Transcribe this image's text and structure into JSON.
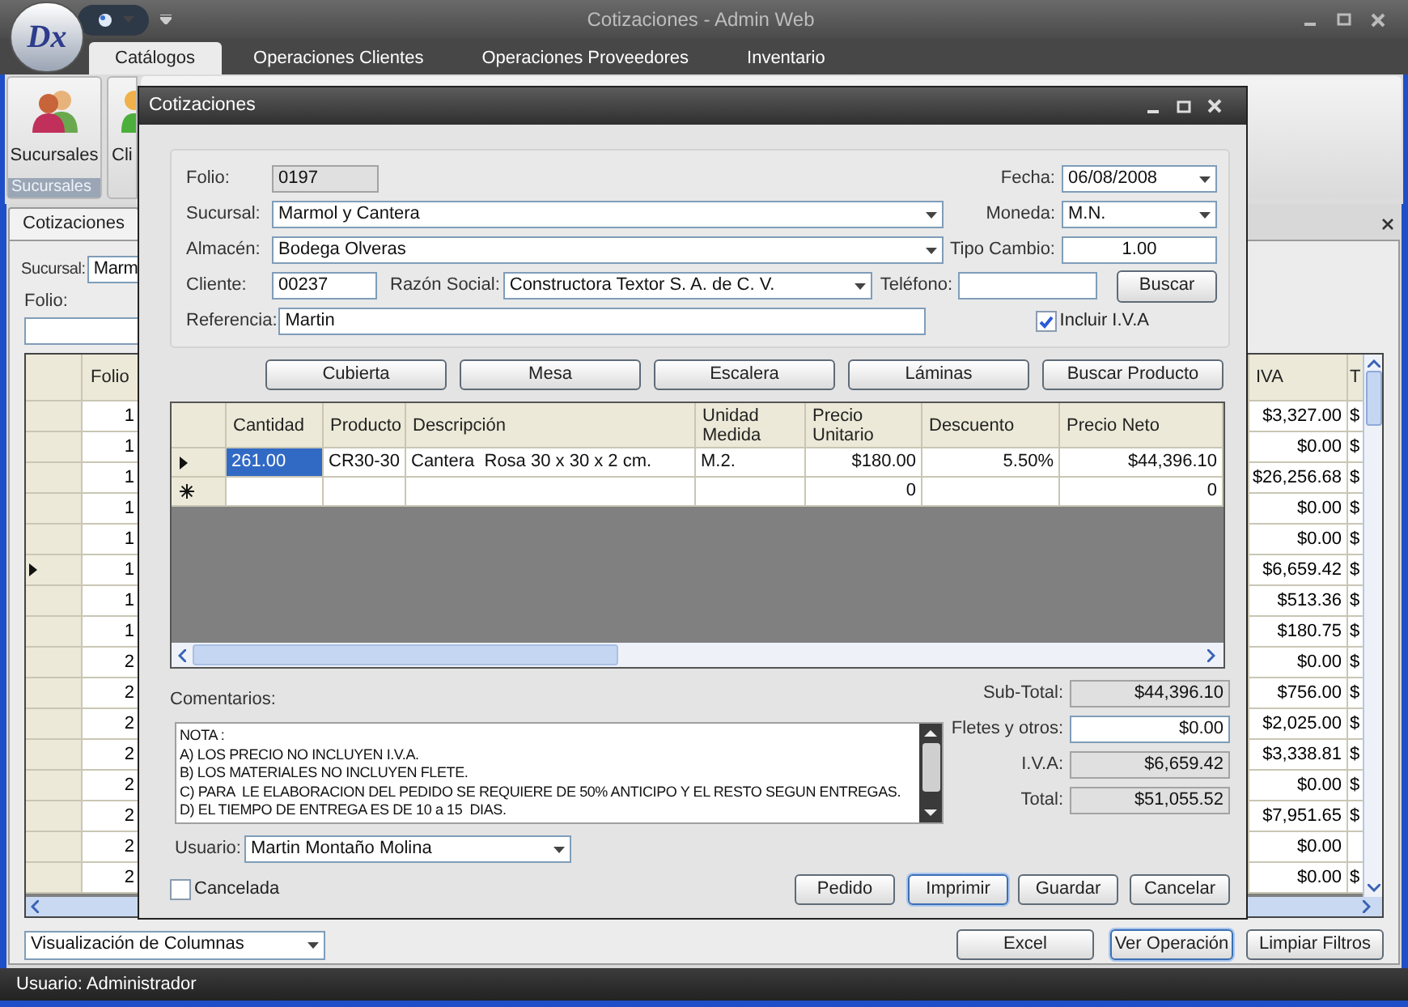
{
  "window": {
    "title": "Cotizaciones - Admin Web",
    "logo": "Dx"
  },
  "ribbon": {
    "tabs": [
      {
        "label": "Catálogos",
        "selected": true
      },
      {
        "label": "Operaciones Clientes",
        "selected": false
      },
      {
        "label": "Operaciones Proveedores",
        "selected": false
      },
      {
        "label": "Inventario",
        "selected": false
      }
    ],
    "buttons": [
      {
        "label": "Sucursales"
      },
      {
        "label": "Cli"
      }
    ],
    "group_label": "Sucursales"
  },
  "document_tabs": [
    {
      "label": "Cotizaciones",
      "selected": true
    }
  ],
  "filters": {
    "sucursal": {
      "label": "Sucursal:",
      "value": "Marm"
    },
    "folio": {
      "label": "Folio:"
    }
  },
  "list_grid": {
    "columns": [
      "Folio",
      "IVA",
      "T"
    ],
    "rows": [
      {
        "folio": "1",
        "iva": "$3,327.00",
        "column_t": "$",
        "current": false
      },
      {
        "folio": "1",
        "iva": "$0.00",
        "column_t": "$",
        "current": false
      },
      {
        "folio": "1",
        "iva": "$26,256.68",
        "column_t": "$",
        "current": false
      },
      {
        "folio": "1",
        "iva": "$0.00",
        "column_t": "$",
        "current": false
      },
      {
        "folio": "1",
        "iva": "$0.00",
        "column_t": "$",
        "current": false
      },
      {
        "folio": "1",
        "iva": "$6,659.42",
        "column_t": "$",
        "current": true
      },
      {
        "folio": "1",
        "iva": "$513.36",
        "column_t": "$",
        "current": false
      },
      {
        "folio": "1",
        "iva": "$180.75",
        "column_t": "$",
        "current": false
      },
      {
        "folio": "2",
        "iva": "$0.00",
        "column_t": "$",
        "current": false
      },
      {
        "folio": "2",
        "iva": "$756.00",
        "column_t": "$",
        "current": false
      },
      {
        "folio": "2",
        "iva": "$2,025.00",
        "column_t": "$",
        "current": false
      },
      {
        "folio": "2",
        "iva": "$3,338.81",
        "column_t": "$",
        "current": false
      },
      {
        "folio": "2",
        "iva": "$0.00",
        "column_t": "$",
        "current": false
      },
      {
        "folio": "2",
        "iva": "$7,951.65",
        "column_t": "$",
        "current": false
      },
      {
        "folio": "2",
        "iva": "$0.00",
        "current": false
      },
      {
        "folio": "2",
        "iva": "$0.00",
        "column_t": "$",
        "current": false
      }
    ]
  },
  "view_select": "Visualización de Columnas",
  "actions": [
    {
      "label": "Excel",
      "focused": false
    },
    {
      "label": "Ver Operación",
      "focused": true
    },
    {
      "label": "Limpiar Filtros",
      "focused": false
    }
  ],
  "status_bar": "Usuario: Administrador",
  "dialog": {
    "title": "Cotizaciones",
    "header": {
      "folio": {
        "label": "Folio:",
        "value": "0197",
        "readonly": true
      },
      "fecha": {
        "label": "Fecha:",
        "value": "06/08/2008"
      },
      "sucursal": {
        "label": "Sucursal:",
        "value": "Marmol y Cantera"
      },
      "moneda": {
        "label": "Moneda:",
        "value": "M.N."
      },
      "almacen": {
        "label": "Almacén:",
        "value": "Bodega Olveras"
      },
      "tipo_cambio": {
        "label": "Tipo Cambio:",
        "value": "1.00"
      },
      "cliente": {
        "label": "Cliente:",
        "value": "00237"
      },
      "razon_social": {
        "label": "Razón Social:",
        "value": "Constructora Textor S. A. de C. V."
      },
      "telefono": {
        "label": "Teléfono:"
      },
      "search_button": "Buscar",
      "referencia": {
        "label": "Referencia:",
        "value": "Martin"
      },
      "include_iva": {
        "label": "Incluir I.V.A",
        "checked": true
      }
    },
    "category_buttons": [
      "Cubierta",
      "Mesa",
      "Escalera",
      "Láminas",
      "Buscar Producto"
    ],
    "lines": {
      "columns": [
        "Cantidad",
        "Producto",
        "Descripción",
        "Unidad Medida",
        "Precio Unitario",
        "Descuento",
        "Precio Neto"
      ],
      "rows": [
        {
          "kind": "current",
          "cells": [
            {
              "text": "261.00",
              "selected": true
            },
            {
              "text": "CR30-30",
              "selected": false
            },
            {
              "text": "Cantera  Rosa 30 x 30 x 2 cm.",
              "selected": false
            },
            {
              "text": "M.2.",
              "selected": false
            },
            {
              "text": "$180.00",
              "selected": false
            },
            {
              "text": "5.50%",
              "selected": false
            },
            {
              "text": "$44,396.10",
              "selected": false
            }
          ]
        },
        {
          "kind": "new",
          "cells": [
            {
              "selected": false
            },
            {
              "selected": false
            },
            {
              "selected": false
            },
            {
              "selected": false
            },
            {
              "text": "0",
              "selected": false
            },
            {
              "selected": false
            },
            {
              "text": "0",
              "selected": false
            }
          ]
        }
      ]
    },
    "comments": {
      "label": "Comentarios:",
      "lines": [
        "NOTA :",
        "A) LOS PRECIO NO INCLUYEN I.V.A.",
        "B) LOS MATERIALES NO INCLUYEN FLETE.",
        "C) PARA  LE ELABORACION DEL PEDIDO SE REQUIERE DE 50% ANTICIPO Y EL RESTO SEGUN ENTREGAS.",
        "D) EL TIEMPO DE ENTREGA ES DE 10 a 15  DIAS."
      ]
    },
    "usuario": {
      "label": "Usuario:",
      "value": "Martin Montaño Molina"
    },
    "cancelada": {
      "label": "Cancelada",
      "checked": false
    },
    "totals": [
      {
        "label": "Sub-Total:",
        "value": "$44,396.10",
        "editable": false
      },
      {
        "label": "Fletes y otros:",
        "value": "$0.00",
        "editable": true
      },
      {
        "label": "I.V.A:",
        "value": "$6,659.42",
        "editable": false
      },
      {
        "label": "Total:",
        "value": "$51,055.52",
        "editable": false
      }
    ],
    "buttons": [
      {
        "label": "Pedido",
        "focused": false
      },
      {
        "label": "Imprimir",
        "focused": true
      },
      {
        "label": "Guardar",
        "focused": false
      },
      {
        "label": "Cancelar",
        "focused": false
      }
    ]
  }
}
